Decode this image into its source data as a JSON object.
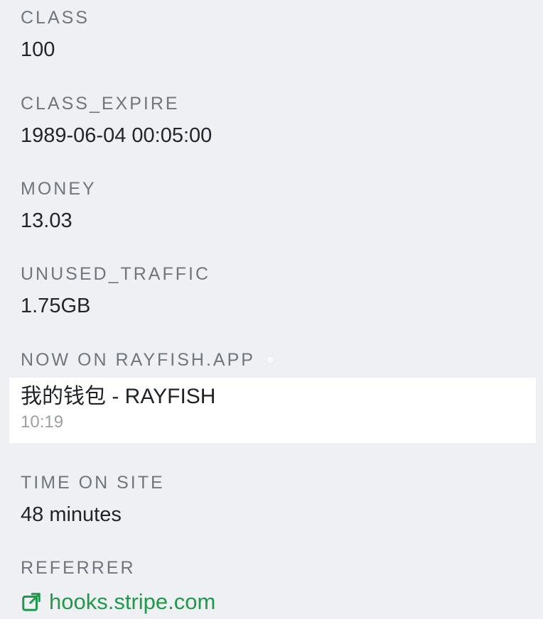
{
  "fields": {
    "class": {
      "label": "CLASS",
      "value": "100"
    },
    "class_expire": {
      "label": "CLASS_EXPIRE",
      "value": "1989-06-04 00:05:00"
    },
    "money": {
      "label": "MONEY",
      "value": "13.03"
    },
    "unused_traffic": {
      "label": "UNUSED_TRAFFIC",
      "value": "1.75GB"
    }
  },
  "now_on": {
    "label": "NOW ON RAYFISH.APP",
    "page_title": "我的钱包 - RAYFISH",
    "time": "10:19"
  },
  "time_on_site": {
    "label": "TIME ON SITE",
    "value": "48 minutes"
  },
  "referrer": {
    "label": "REFERRER",
    "link_text": "hooks.stripe.com",
    "icon": "external-link-icon"
  },
  "colors": {
    "background": "#eef0f3",
    "label": "#6f767d",
    "value": "#22262a",
    "card": "#ffffff",
    "link": "#1f9a4c",
    "muted": "#9aa0a6"
  }
}
